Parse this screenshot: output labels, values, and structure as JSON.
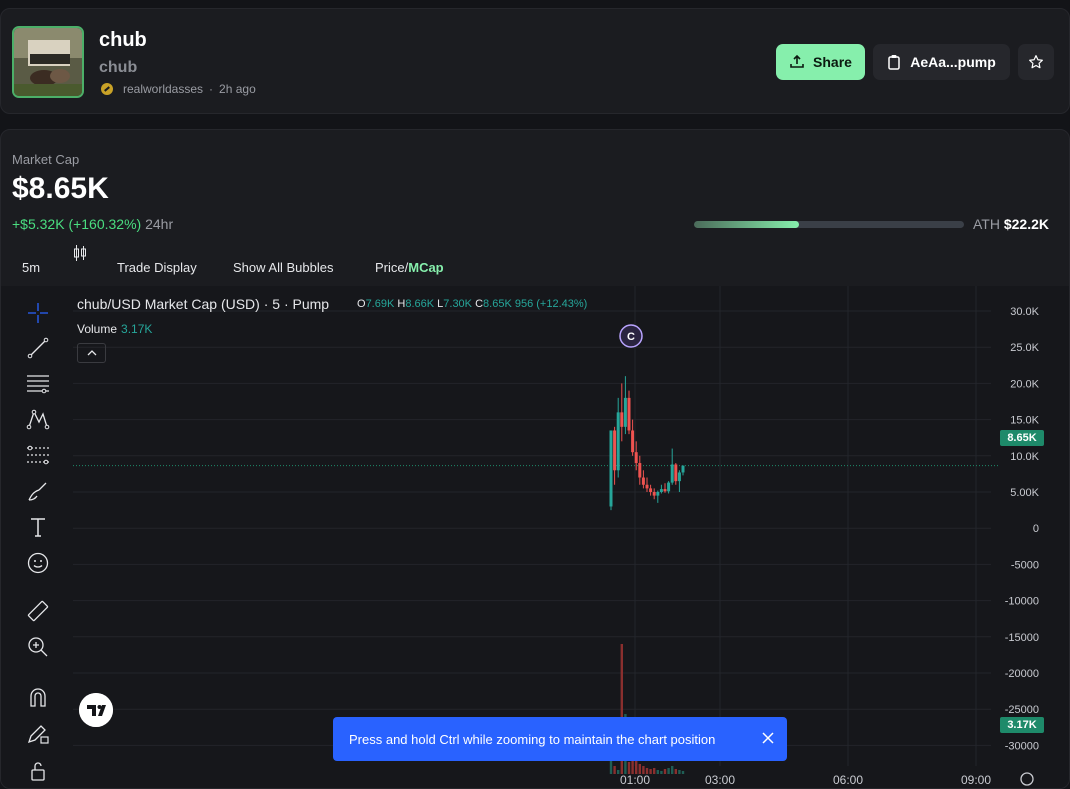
{
  "token": {
    "name": "chub",
    "ticker": "chub",
    "creator": "realworldasses",
    "separator": "·",
    "age": "2h ago"
  },
  "actions": {
    "share_label": "Share",
    "address_label": "AeAa...pump"
  },
  "market": {
    "label": "Market Cap",
    "value": "$8.65K",
    "change": "+$5.32K (+160.32%)",
    "period": "24hr",
    "ath_label": "ATH",
    "ath_value": "$22.2K",
    "ath_progress": 0.39
  },
  "toolbar": {
    "interval": "5m",
    "trade_display": "Trade Display",
    "show_bubbles": "Show All Bubbles",
    "price_label": "Price/",
    "mcap_label": "MCap"
  },
  "legend": {
    "title": "chub/USD Market Cap (USD) · 5 · Pump",
    "o_key": "O",
    "o_val": "7.69K",
    "h_key": "H",
    "h_val": "8.66K",
    "l_key": "L",
    "l_val": "7.30K",
    "c_key": "C",
    "c_val": "8.65K 956 (+12.43%)",
    "volume_label": "Volume",
    "volume_value": "3.17K"
  },
  "chart_data": {
    "type": "candlestick",
    "y_ticks": [
      "30.0K",
      "25.0K",
      "20.0K",
      "15.0K",
      "10.0K",
      "5.00K",
      "0",
      "-5000",
      "-10000",
      "-15000",
      "-20000",
      "-25000",
      "-30000"
    ],
    "x_ticks": [
      "01:00",
      "03:00",
      "06:00",
      "09:00"
    ],
    "last_price_tag": "8.65K",
    "volume_tag": "3.17K",
    "marker": "C"
  },
  "toast": {
    "message": "Press and hold Ctrl while zooming to maintain the chart position"
  },
  "colors": {
    "accent": "#86efac",
    "up": "#26a69a",
    "down": "#ef5350",
    "toast": "#2962ff"
  }
}
